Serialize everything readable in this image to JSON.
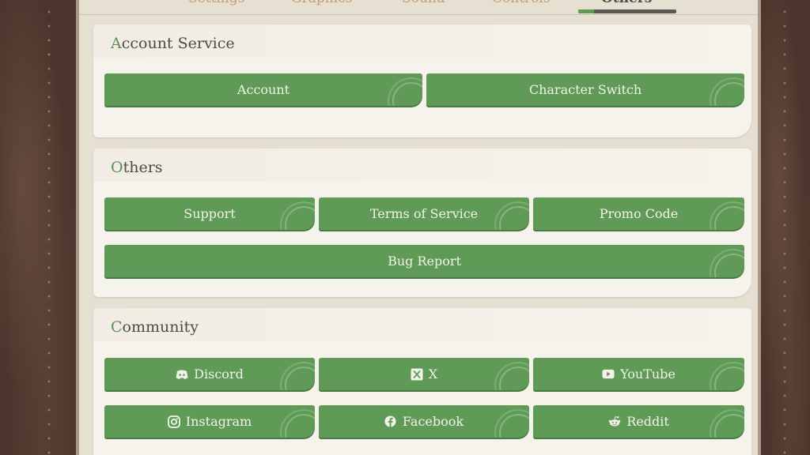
{
  "tabs": [
    {
      "label": "Settings"
    },
    {
      "label": "Graphics"
    },
    {
      "label": "Sound"
    },
    {
      "label": "Controls"
    },
    {
      "label": "Others"
    }
  ],
  "account_service": {
    "title_first": "A",
    "title_rest": "ccount Service",
    "buttons": [
      {
        "label": "Account"
      },
      {
        "label": "Character Switch"
      }
    ]
  },
  "others": {
    "title_first": "O",
    "title_rest": "thers",
    "buttons": [
      {
        "label": "Support"
      },
      {
        "label": "Terms of Service"
      },
      {
        "label": "Promo Code"
      },
      {
        "label": "Bug Report"
      }
    ]
  },
  "community": {
    "title_first": "C",
    "title_rest": "ommunity",
    "buttons": [
      {
        "label": "Discord",
        "icon": "discord-icon"
      },
      {
        "label": "X",
        "icon": "x-icon"
      },
      {
        "label": "YouTube",
        "icon": "youtube-icon"
      },
      {
        "label": "Instagram",
        "icon": "instagram-icon"
      },
      {
        "label": "Facebook",
        "icon": "facebook-icon"
      },
      {
        "label": "Reddit",
        "icon": "reddit-icon"
      }
    ]
  },
  "colors": {
    "button_green": "#5f9b57",
    "accent_green": "#5b8f52",
    "panel": "#f6f3ec",
    "frame": "#e6e0d2"
  }
}
